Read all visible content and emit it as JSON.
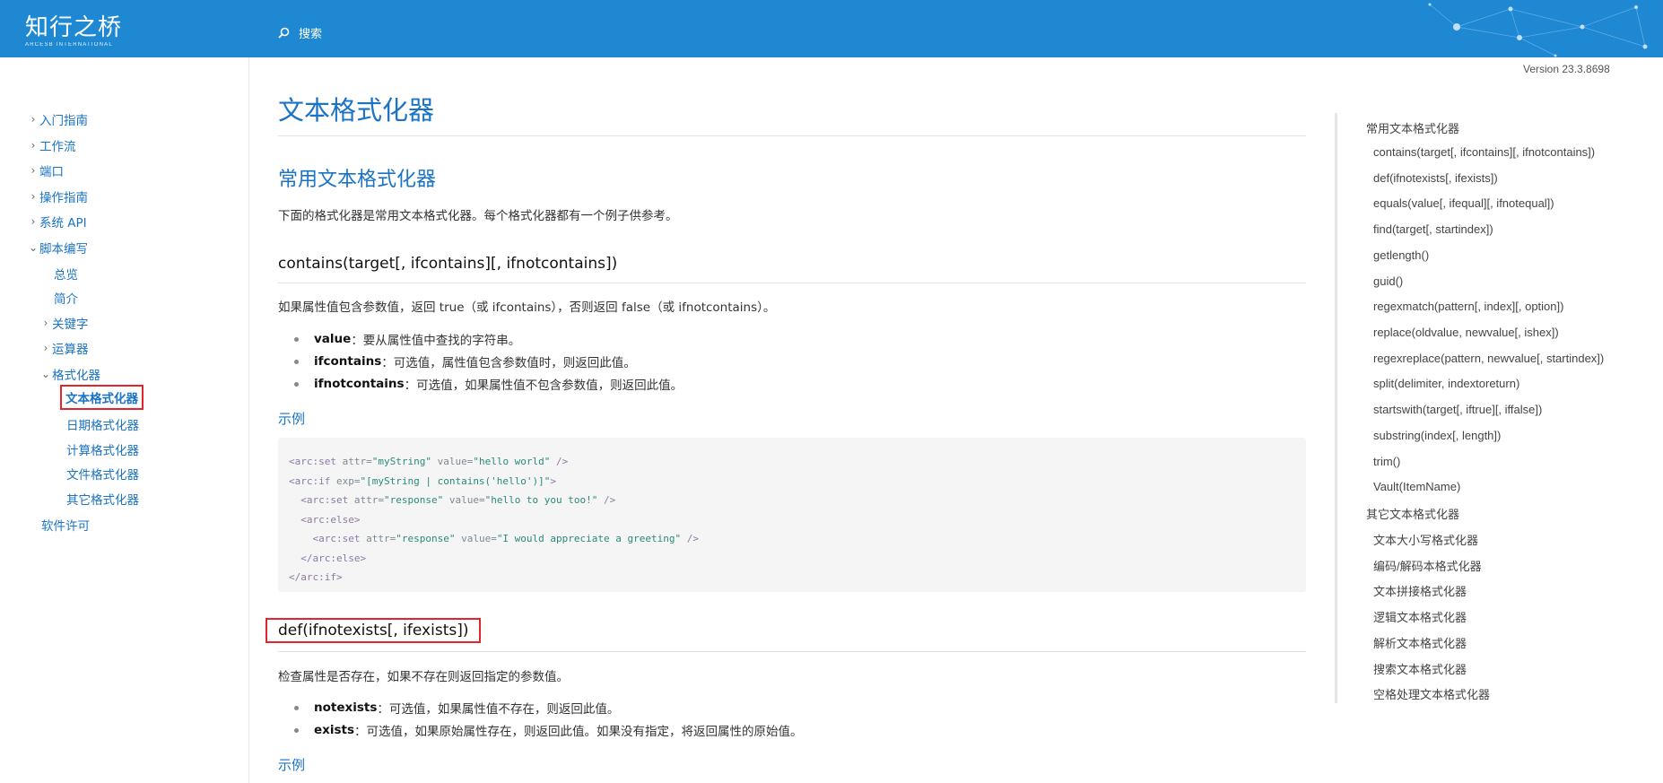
{
  "header": {
    "logo_main": "知行之桥",
    "logo_sub": "ARCESB INTERNATIONAL",
    "search_label": "搜索",
    "version": "Version 23.3.8698"
  },
  "sidebar": {
    "items": [
      {
        "label": "入门指南"
      },
      {
        "label": "工作流"
      },
      {
        "label": "端口"
      },
      {
        "label": "操作指南"
      },
      {
        "label": "系统 API"
      },
      {
        "label": "脚本编写"
      },
      {
        "label": "总览"
      },
      {
        "label": "简介"
      },
      {
        "label": "关键字"
      },
      {
        "label": "运算器"
      },
      {
        "label": "格式化器"
      },
      {
        "label": "文本格式化器"
      },
      {
        "label": "日期格式化器"
      },
      {
        "label": "计算格式化器"
      },
      {
        "label": "文件格式化器"
      },
      {
        "label": "其它格式化器"
      },
      {
        "label": "软件许可"
      }
    ]
  },
  "main": {
    "title": "文本格式化器",
    "section_title": "常用文本格式化器",
    "intro": "下面的格式化器是常用文本格式化器。每个格式化器都有一个例子供参考。",
    "contains": {
      "heading": "contains(target[, ifcontains][, ifnotcontains])",
      "desc": "如果属性值包含参数值，返回 true（或 ifcontains），否则返回 false（或 ifnotcontains）。",
      "params": [
        {
          "name": "value",
          "text": "：要从属性值中查找的字符串。"
        },
        {
          "name": "ifcontains",
          "text": "：可选值，属性值包含参数值时，则返回此值。"
        },
        {
          "name": "ifnotcontains",
          "text": "：可选值，如果属性值不包含参数值，则返回此值。"
        }
      ],
      "example_label": "示例",
      "code": {
        "l1_tag": "<arc:set ",
        "l1_a1": "attr=",
        "l1_v1": "\"myString\"",
        "l1_a2": " value=",
        "l1_v2": "\"hello world\"",
        "l1_end": " />",
        "l2_tag": "<arc:if ",
        "l2_a1": "exp=",
        "l2_v1": "\"[myString | contains('hello')]\"",
        "l2_end": ">",
        "l3_tag": "  <arc:set ",
        "l3_a1": "attr=",
        "l3_v1": "\"response\"",
        "l3_a2": " value=",
        "l3_v2": "\"hello to you too!\"",
        "l3_end": " />",
        "l4_tag": "  <arc:else>",
        "l5_tag": "    <arc:set ",
        "l5_a1": "attr=",
        "l5_v1": "\"response\"",
        "l5_a2": " value=",
        "l5_v2": "\"I would appreciate a greeting\"",
        "l5_end": " />",
        "l6_tag": "  </arc:else>",
        "l7_tag": "</arc:if>"
      }
    },
    "def": {
      "heading": "def(ifnotexists[, ifexists])",
      "desc": "检查属性是否存在，如果不存在则返回指定的参数值。",
      "params": [
        {
          "name": "notexists",
          "text": "：可选值，如果属性值不存在，则返回此值。"
        },
        {
          "name": "exists",
          "text": "：可选值，如果原始属性存在，则返回此值。如果没有指定，将返回属性的原始值。"
        }
      ],
      "example_label": "示例"
    }
  },
  "toc": {
    "items": [
      {
        "label": "常用文本格式化器",
        "level": 1
      },
      {
        "label": "contains(target[, ifcontains][, ifnotcontains])",
        "level": 2
      },
      {
        "label": "def(ifnotexists[, ifexists])",
        "level": 2
      },
      {
        "label": "equals(value[, ifequal][, ifnotequal])",
        "level": 2
      },
      {
        "label": "find(target[, startindex])",
        "level": 2
      },
      {
        "label": "getlength()",
        "level": 2
      },
      {
        "label": "guid()",
        "level": 2
      },
      {
        "label": "regexmatch(pattern[, index][, option])",
        "level": 2
      },
      {
        "label": "replace(oldvalue, newvalue[, ishex])",
        "level": 2
      },
      {
        "label": "regexreplace(pattern, newvalue[, startindex])",
        "level": 2
      },
      {
        "label": "split(delimiter, indextoreturn)",
        "level": 2
      },
      {
        "label": "startswith(target[, iftrue][, iffalse])",
        "level": 2
      },
      {
        "label": "substring(index[, length])",
        "level": 2
      },
      {
        "label": "trim()",
        "level": 2
      },
      {
        "label": "Vault(ItemName)",
        "level": 2
      },
      {
        "label": "其它文本格式化器",
        "level": 1
      },
      {
        "label": "文本大小写格式化器",
        "level": 2
      },
      {
        "label": "编码/解码本格式化器",
        "level": 2
      },
      {
        "label": "文本拼接格式化器",
        "level": 2
      },
      {
        "label": "逻辑文本格式化器",
        "level": 2
      },
      {
        "label": "解析文本格式化器",
        "level": 2
      },
      {
        "label": "搜索文本格式化器",
        "level": 2
      },
      {
        "label": "空格处理文本格式化器",
        "level": 2
      }
    ]
  },
  "colors": {
    "header_bg": "#1e88d2",
    "link": "#1a73c5",
    "highlight_box": "#e0262c"
  }
}
